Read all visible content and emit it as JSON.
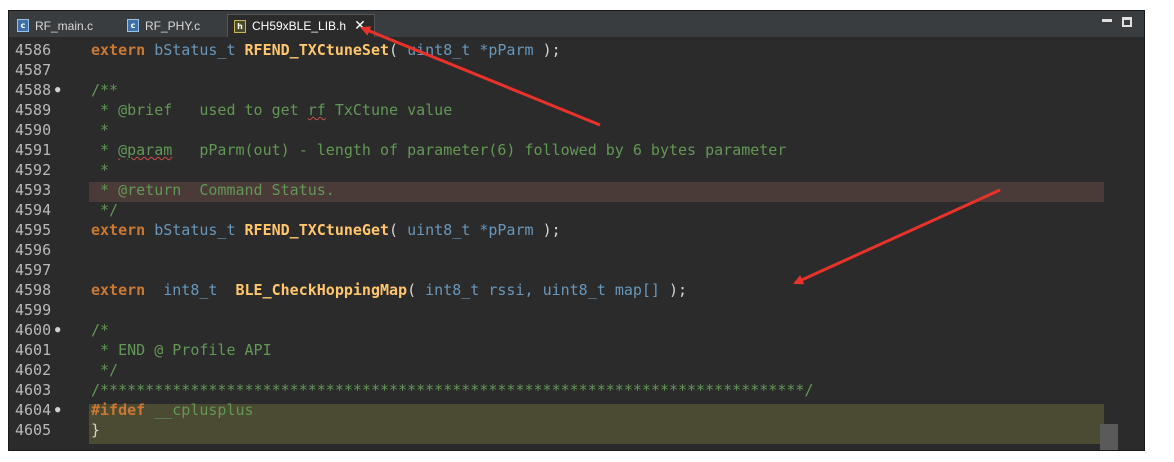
{
  "tabs": [
    {
      "label": "RF_main.c",
      "icon": "c-file-icon",
      "icon_glyph": "c"
    },
    {
      "label": "RF_PHY.c",
      "icon": "c-file-icon",
      "icon_glyph": "c"
    },
    {
      "label": "CH59xBLE_LIB.h",
      "icon": "h-file-icon",
      "icon_glyph": "h",
      "active": true,
      "close_glyph": "✕"
    }
  ],
  "window_controls": {
    "minimize": "minimize-icon",
    "maximize": "maximize-icon"
  },
  "lines": [
    {
      "num": "4586",
      "marker": ""
    },
    {
      "num": "4587",
      "marker": ""
    },
    {
      "num": "4588",
      "marker": "●"
    },
    {
      "num": "4589",
      "marker": ""
    },
    {
      "num": "4590",
      "marker": ""
    },
    {
      "num": "4591",
      "marker": ""
    },
    {
      "num": "4592",
      "marker": ""
    },
    {
      "num": "4593",
      "marker": ""
    },
    {
      "num": "4594",
      "marker": ""
    },
    {
      "num": "4595",
      "marker": ""
    },
    {
      "num": "4596",
      "marker": ""
    },
    {
      "num": "4597",
      "marker": ""
    },
    {
      "num": "4598",
      "marker": ""
    },
    {
      "num": "4599",
      "marker": ""
    },
    {
      "num": "4600",
      "marker": "●"
    },
    {
      "num": "4601",
      "marker": ""
    },
    {
      "num": "4602",
      "marker": ""
    },
    {
      "num": "4603",
      "marker": ""
    },
    {
      "num": "4604",
      "marker": "●"
    },
    {
      "num": "4605",
      "marker": ""
    }
  ],
  "code": {
    "l4586": {
      "kw": "extern",
      "type": "bStatus_t",
      "fn": "RFEND_TXCtuneSet",
      "open": "(",
      "ptype": "uint8_t",
      "param": "*pParm",
      "close": ");"
    },
    "l4588": "/**",
    "l4589": {
      "pre": " * @brief   used to get ",
      "squig": "rf",
      "post": " TxCtune value"
    },
    "l4590": " *",
    "l4591": {
      "pre": " * ",
      "squig": "@param",
      "post": "   pParm(out) - length of parameter(6) followed by 6 bytes parameter"
    },
    "l4592": " *",
    "l4593": " * @return  Command Status.",
    "l4594": " */",
    "l4595": {
      "kw": "extern",
      "type": "bStatus_t",
      "fn": "RFEND_TXCtuneGet",
      "open": "(",
      "ptype": "uint8_t",
      "param": "*pParm",
      "close": ");"
    },
    "l4598": {
      "kw": "extern",
      "type": "int8_t",
      "fn": "BLE_CheckHoppingMap",
      "open": "(",
      "ptype1": "int8_t",
      "param1": "rssi,",
      "ptype2": "uint8_t",
      "param2": "map[]",
      "close": ");"
    },
    "l4600": "/*",
    "l4601": " * END @ Profile API",
    "l4602": " */",
    "l4603": "/******************************************************************************/",
    "l4604": {
      "pp": "#ifdef",
      "macro": "__cplusplus"
    },
    "l4605": "}"
  },
  "colors": {
    "background": "#2b2b2b",
    "keyword": "#cc7832",
    "type": "#6897bb",
    "function": "#ffc66d",
    "comment": "#629755",
    "highlight_line": "#4a3a38",
    "highlight_ifdef": "#4b4a32",
    "annotation_arrow": "#e8322b"
  }
}
